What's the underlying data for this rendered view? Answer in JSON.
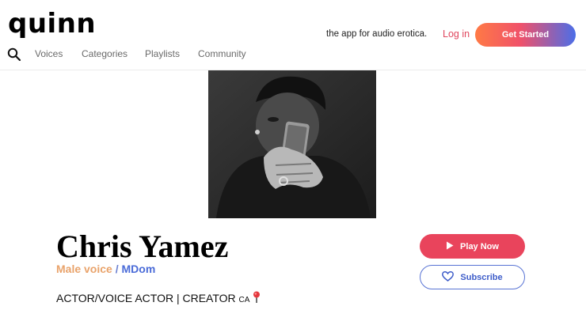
{
  "header": {
    "logo": "quinn",
    "tagline": "the app for audio erotica.",
    "login_label": "Log in",
    "cta_label": "Get Started",
    "nav": [
      "Voices",
      "Categories",
      "Playlists",
      "Community"
    ]
  },
  "profile": {
    "name": "Chris Yamez",
    "tag_primary": "Male voice",
    "tag_separator": " / ",
    "tag_secondary": "MDom",
    "bio": "ACTOR/VOICE ACTOR | CREATOR",
    "bio_suffix": "CA",
    "play_label": "Play Now",
    "subscribe_label": "Subscribe"
  },
  "icons": [
    "search-icon",
    "play-icon",
    "heart-icon",
    "pin-icon"
  ],
  "colors": {
    "accent": "#e9445c",
    "brand_blue": "#4a6bd8",
    "tag_orange": "#e9a36b"
  }
}
